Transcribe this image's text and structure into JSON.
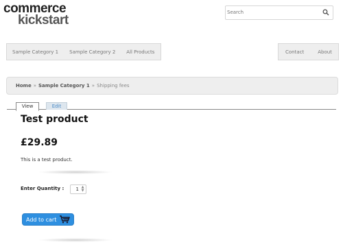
{
  "logo": {
    "line1": "commerce",
    "line2_k": "k",
    "line2_rest": "ickstart"
  },
  "search": {
    "placeholder": "Search",
    "icon": "magnifier-icon"
  },
  "nav": {
    "left": [
      "Sample Category 1",
      "Sample Category 2",
      "All Products"
    ],
    "right": [
      "Contact",
      "About"
    ]
  },
  "breadcrumb": {
    "home": "Home",
    "category": "Sample Category 1",
    "current": "Shipping fees",
    "separator": "»"
  },
  "tabs": {
    "view": "View",
    "edit": "Edit"
  },
  "product": {
    "title": "Test product",
    "price": "£29.89",
    "description": "This is a test product."
  },
  "quantity": {
    "label": "Enter Quantity :",
    "value": "1"
  },
  "cart": {
    "button_label": "Add to cart",
    "icon": "cart-icon"
  },
  "colors": {
    "accent": "#2e8fe0",
    "nav_bg": "#eeeeee"
  }
}
